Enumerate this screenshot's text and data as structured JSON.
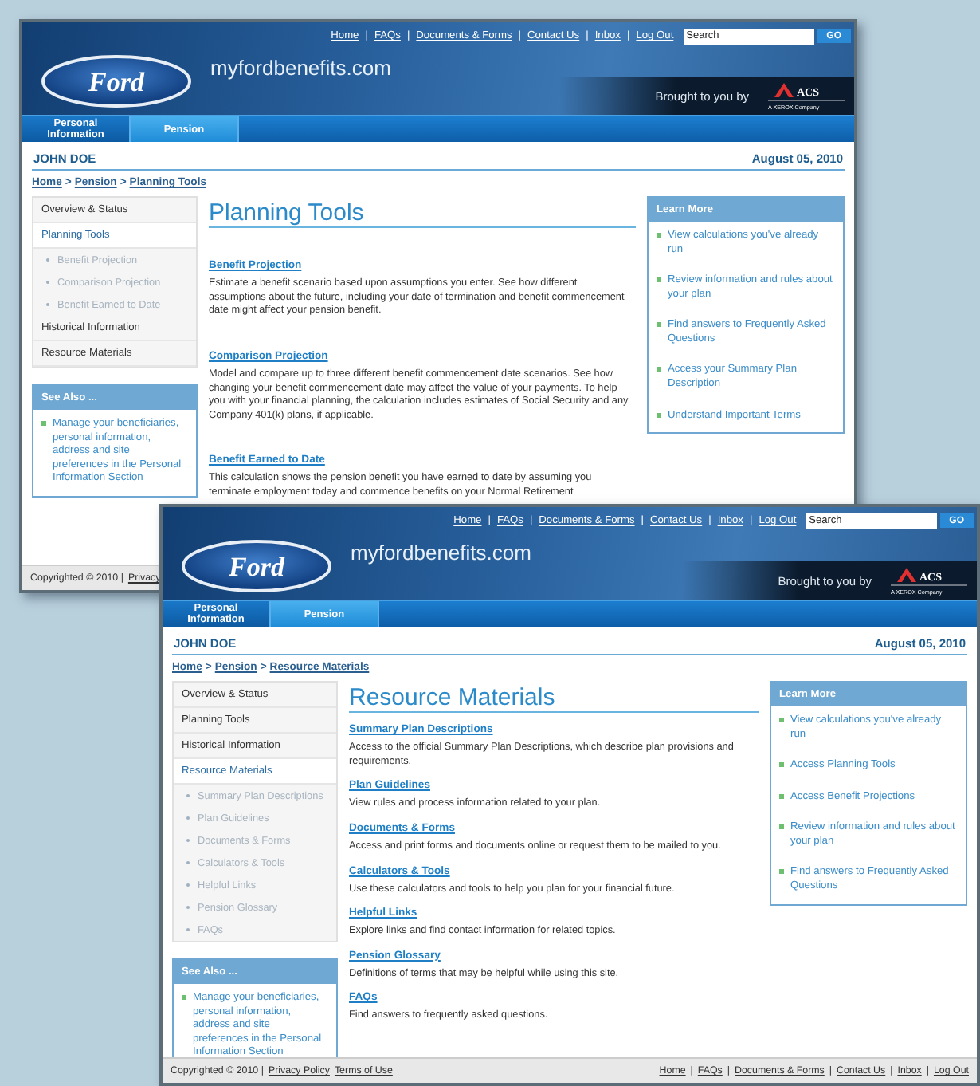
{
  "windows": [
    {
      "header": {
        "links": [
          {
            "kind": "link",
            "text": "Home"
          },
          {
            "kind": "sep",
            "text": "|"
          },
          {
            "kind": "link",
            "text": "FAQs"
          },
          {
            "kind": "sep",
            "text": "|"
          },
          {
            "kind": "link",
            "text": "Documents & Forms"
          },
          {
            "kind": "sep",
            "text": "|"
          },
          {
            "kind": "link",
            "text": "Contact Us"
          },
          {
            "kind": "sep",
            "text": "|"
          },
          {
            "kind": "link",
            "text": "Inbox"
          },
          {
            "kind": "sep",
            "text": "|"
          },
          {
            "kind": "link",
            "text": "Log Out"
          }
        ],
        "search": {
          "placeholder": "Search"
        },
        "go": "GO",
        "logo": "Ford",
        "site": "myfordbenefits.com",
        "brought": "Brought to you by",
        "sponsor": {
          "name": "ACS",
          "tagline": "A XEROX Company"
        }
      },
      "tabs": [
        {
          "label": "Personal Information",
          "selected": false
        },
        {
          "label": "Pension",
          "selected": true
        }
      ],
      "user": "JOHN DOE",
      "date": "August 05, 2010",
      "breadcrumb": [
        {
          "kind": "link",
          "text": "Home"
        },
        {
          "kind": "sep",
          "text": ">"
        },
        {
          "kind": "link",
          "text": "Pension"
        },
        {
          "kind": "sep",
          "text": ">"
        },
        {
          "kind": "link",
          "text": "Planning Tools"
        }
      ],
      "nav": [
        {
          "label": "Overview & Status",
          "selected": false
        },
        {
          "label": "Planning Tools",
          "selected": true,
          "children": [
            {
              "label": "Benefit Projection"
            },
            {
              "label": "Comparison Projection"
            },
            {
              "label": "Benefit Earned to Date"
            }
          ]
        },
        {
          "label": "Historical Information",
          "selected": false
        },
        {
          "label": "Resource Materials",
          "selected": false
        }
      ],
      "see_also": {
        "title": "See Also ...",
        "items": [
          "Manage your beneficiaries, personal information, address and site preferences in the Personal Information Section"
        ]
      },
      "title": "Planning Tools",
      "sections": [
        {
          "title": "Benefit Projection",
          "text": "Estimate a benefit scenario based upon assumptions you enter. See how different assumptions about the future, including your date of termination and benefit commencement date might affect your pension benefit."
        },
        {
          "title": "Comparison Projection",
          "text": "Model and compare up to three different benefit commencement date scenarios. See how changing your benefit commencement date may affect the value of your payments. To help you with your financial planning, the calculation includes estimates of Social Security and any Company 401(k) plans, if applicable."
        },
        {
          "title": "Benefit Earned to Date",
          "text": "This calculation shows the pension benefit you have earned to date by assuming you terminate employment today and commence benefits on your Normal Retirement"
        }
      ],
      "learn_more": {
        "title": "Learn More",
        "items": [
          "View calculations you've already run",
          "Review information and rules about your plan",
          "Find answers to Frequently Asked Questions",
          "Access your Summary Plan Description",
          "Understand Important Terms"
        ]
      },
      "footer": {
        "left": [
          {
            "kind": "text",
            "text": "Copyrighted © 2010 |"
          },
          {
            "kind": "link",
            "text": "Privacy"
          }
        ]
      }
    },
    {
      "header": {
        "links": [
          {
            "kind": "link",
            "text": "Home"
          },
          {
            "kind": "sep",
            "text": "|"
          },
          {
            "kind": "link",
            "text": "FAQs"
          },
          {
            "kind": "sep",
            "text": "|"
          },
          {
            "kind": "link",
            "text": "Documents & Forms"
          },
          {
            "kind": "sep",
            "text": "|"
          },
          {
            "kind": "link",
            "text": "Contact Us"
          },
          {
            "kind": "sep",
            "text": "|"
          },
          {
            "kind": "link",
            "text": "Inbox"
          },
          {
            "kind": "sep",
            "text": "|"
          },
          {
            "kind": "link",
            "text": "Log Out"
          }
        ],
        "search": {
          "placeholder": "Search"
        },
        "go": "GO",
        "logo": "Ford",
        "site": "myfordbenefits.com",
        "brought": "Brought to you by",
        "sponsor": {
          "name": "ACS",
          "tagline": "A XEROX Company"
        }
      },
      "tabs": [
        {
          "label": "Personal Information",
          "selected": false
        },
        {
          "label": "Pension",
          "selected": true
        }
      ],
      "user": "JOHN DOE",
      "date": "August 05, 2010",
      "breadcrumb": [
        {
          "kind": "link",
          "text": "Home"
        },
        {
          "kind": "sep",
          "text": ">"
        },
        {
          "kind": "link",
          "text": "Pension"
        },
        {
          "kind": "sep",
          "text": ">"
        },
        {
          "kind": "link",
          "text": "Resource Materials"
        }
      ],
      "nav": [
        {
          "label": "Overview & Status",
          "selected": false
        },
        {
          "label": "Planning Tools",
          "selected": false
        },
        {
          "label": "Historical Information",
          "selected": false
        },
        {
          "label": "Resource Materials",
          "selected": true,
          "children": [
            {
              "label": "Summary Plan Descriptions"
            },
            {
              "label": "Plan Guidelines"
            },
            {
              "label": "Documents & Forms"
            },
            {
              "label": "Calculators & Tools"
            },
            {
              "label": "Helpful Links"
            },
            {
              "label": "Pension Glossary"
            },
            {
              "label": "FAQs"
            }
          ]
        }
      ],
      "see_also": {
        "title": "See Also ...",
        "items": [
          "Manage your beneficiaries, personal information, address and site preferences in the Personal Information Section"
        ]
      },
      "title": "Resource Materials",
      "sections": [
        {
          "title": "Summary Plan Descriptions",
          "text": "Access to the official Summary Plan Descriptions, which describe plan provisions and requirements."
        },
        {
          "title": "Plan Guidelines",
          "text": "View rules and process information related to your plan."
        },
        {
          "title": "Documents & Forms",
          "text": "Access and print forms and documents online or request them to be mailed to you."
        },
        {
          "title": "Calculators & Tools",
          "text": "Use these calculators and tools to help you plan for your financial future."
        },
        {
          "title": "Helpful Links",
          "text": "Explore links and find contact information for related topics."
        },
        {
          "title": "Pension Glossary",
          "text": "Definitions of terms that may be helpful while using this site."
        },
        {
          "title": "FAQs",
          "text": "Find answers to frequently asked questions."
        }
      ],
      "learn_more": {
        "title": "Learn More",
        "items": [
          "View calculations you've already run",
          "Access Planning Tools",
          "Access Benefit Projections",
          "Review information and rules about your plan",
          "Find answers to Frequently Asked Questions"
        ]
      },
      "footer": {
        "left": [
          {
            "kind": "text",
            "text": "Copyrighted © 2010 |"
          },
          {
            "kind": "link",
            "text": "Privacy Policy"
          },
          {
            "kind": "link",
            "text": "Terms of Use"
          }
        ],
        "right": [
          {
            "kind": "link",
            "text": "Home"
          },
          {
            "kind": "sep",
            "text": "|"
          },
          {
            "kind": "link",
            "text": "FAQs"
          },
          {
            "kind": "sep",
            "text": "|"
          },
          {
            "kind": "link",
            "text": "Documents & Forms"
          },
          {
            "kind": "sep",
            "text": "|"
          },
          {
            "kind": "link",
            "text": "Contact Us"
          },
          {
            "kind": "sep",
            "text": "|"
          },
          {
            "kind": "link",
            "text": "Inbox"
          },
          {
            "kind": "sep",
            "text": "|"
          },
          {
            "kind": "link",
            "text": "Log Out"
          }
        ]
      }
    }
  ]
}
